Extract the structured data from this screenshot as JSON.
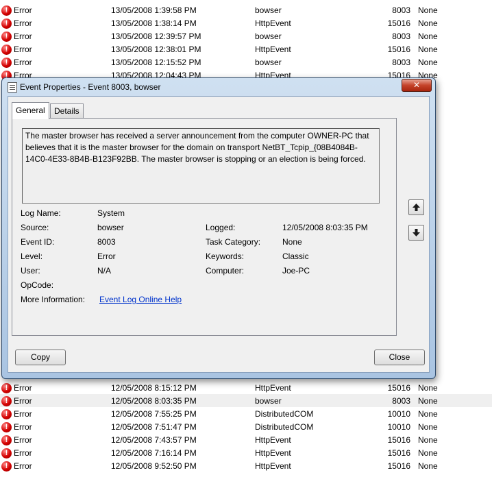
{
  "event_list": {
    "rows_top": [
      {
        "level": "Error",
        "date": "13/05/2008 1:39:58 PM",
        "source": "bowser",
        "event_id": "8003",
        "category": "None"
      },
      {
        "level": "Error",
        "date": "13/05/2008 1:38:14 PM",
        "source": "HttpEvent",
        "event_id": "15016",
        "category": "None"
      },
      {
        "level": "Error",
        "date": "13/05/2008 12:39:57 PM",
        "source": "bowser",
        "event_id": "8003",
        "category": "None"
      },
      {
        "level": "Error",
        "date": "13/05/2008 12:38:01 PM",
        "source": "HttpEvent",
        "event_id": "15016",
        "category": "None"
      },
      {
        "level": "Error",
        "date": "13/05/2008 12:15:52 PM",
        "source": "bowser",
        "event_id": "8003",
        "category": "None"
      },
      {
        "level": "Error",
        "date": "13/05/2008 12:04:43 PM",
        "source": "HttpEvent",
        "event_id": "15016",
        "category": "None"
      }
    ],
    "rows_bottom": [
      {
        "level": "Error",
        "date": "12/05/2008 8:15:12 PM",
        "source": "HttpEvent",
        "event_id": "15016",
        "category": "None"
      },
      {
        "level": "Error",
        "date": "12/05/2008 8:03:35 PM",
        "source": "bowser",
        "event_id": "8003",
        "category": "None"
      },
      {
        "level": "Error",
        "date": "12/05/2008 7:55:25 PM",
        "source": "DistributedCOM",
        "event_id": "10010",
        "category": "None"
      },
      {
        "level": "Error",
        "date": "12/05/2008 7:51:47 PM",
        "source": "DistributedCOM",
        "event_id": "10010",
        "category": "None"
      },
      {
        "level": "Error",
        "date": "12/05/2008 7:43:57 PM",
        "source": "HttpEvent",
        "event_id": "15016",
        "category": "None"
      },
      {
        "level": "Error",
        "date": "12/05/2008 7:16:14 PM",
        "source": "HttpEvent",
        "event_id": "15016",
        "category": "None"
      },
      {
        "level": "Error",
        "date": "12/05/2008 9:52:50 PM",
        "source": "HttpEvent",
        "event_id": "15016",
        "category": "None"
      }
    ],
    "error_icon_glyph": "!",
    "error_icon_color": "#d40000"
  },
  "dialog": {
    "title": "Event Properties - Event 8003, bowser",
    "close_glyph": "✕",
    "tabs": [
      {
        "label": "General",
        "active": true
      },
      {
        "label": "Details",
        "active": false
      }
    ],
    "description": "The master browser has received a server announcement from the computer OWNER-PC that believes that it is the master browser for the domain on transport NetBT_Tcpip_{08B4084B-14C0-4E33-8B4B-B123F92BB. The master browser is stopping or an election is being forced.",
    "fields": {
      "log_name": {
        "label": "Log Name:",
        "value": "System"
      },
      "source": {
        "label": "Source:",
        "value": "bowser"
      },
      "logged": {
        "label": "Logged:",
        "value": "12/05/2008 8:03:35 PM"
      },
      "event_id": {
        "label": "Event ID:",
        "value": "8003"
      },
      "task_category": {
        "label": "Task Category:",
        "value": "None"
      },
      "level": {
        "label": "Level:",
        "value": "Error"
      },
      "keywords": {
        "label": "Keywords:",
        "value": "Classic"
      },
      "user": {
        "label": "User:",
        "value": "N/A"
      },
      "computer": {
        "label": "Computer:",
        "value": "Joe-PC"
      },
      "opcode": {
        "label": "OpCode:",
        "value": ""
      },
      "more_info": {
        "label": "More Information:",
        "link": "Event Log Online Help"
      }
    },
    "nav": {
      "up_icon": "arrow-up-icon",
      "down_icon": "arrow-down-icon"
    },
    "buttons": {
      "copy": "Copy",
      "close": "Close"
    },
    "link_color": "#0033cc",
    "title_bar_color": "#a9c4e2"
  }
}
